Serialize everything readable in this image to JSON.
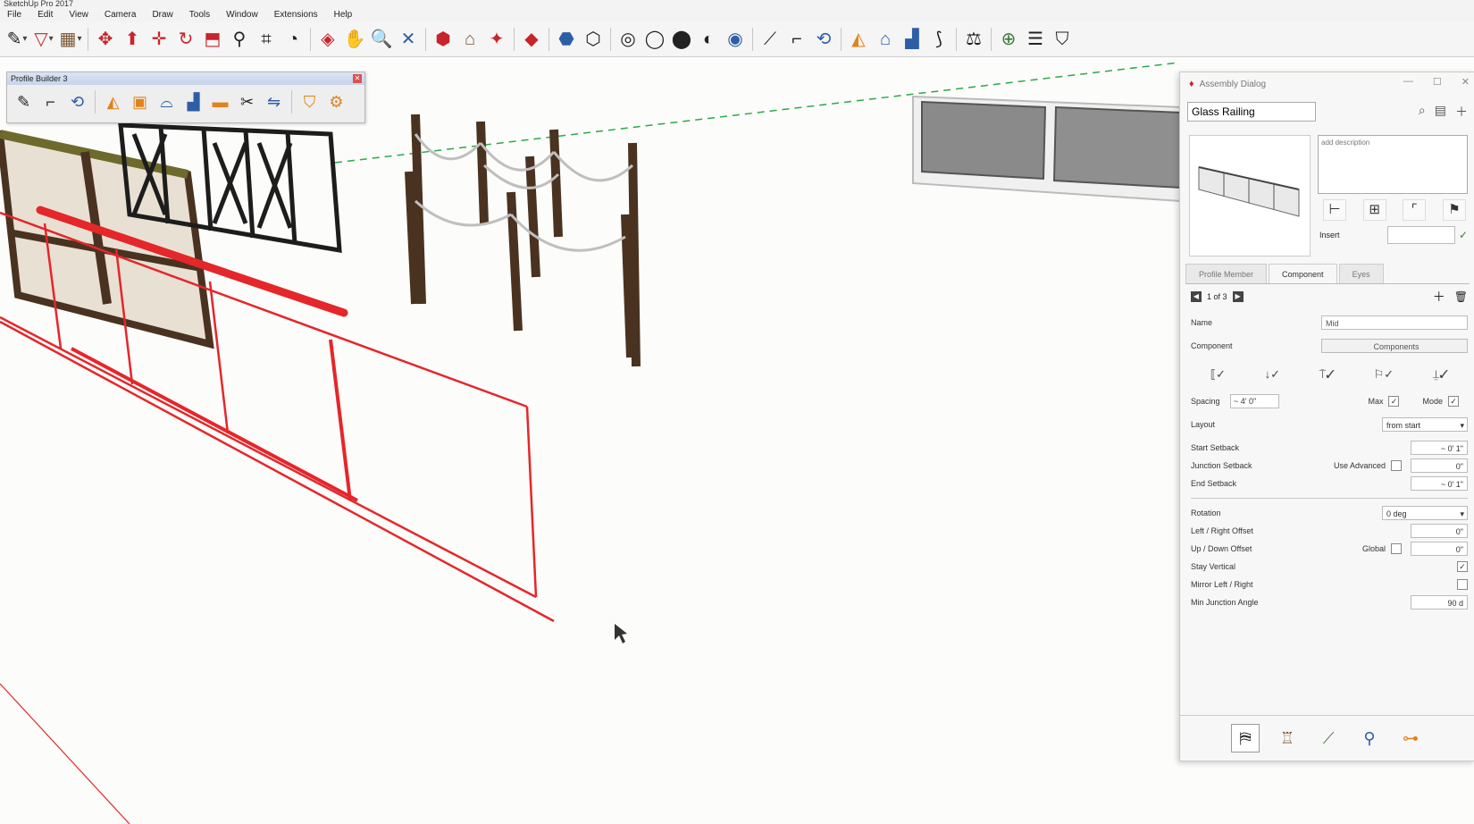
{
  "app": {
    "title": "SketchUp Pro 2017"
  },
  "menus": [
    "File",
    "Edit",
    "View",
    "Camera",
    "Draw",
    "Tools",
    "Window",
    "Extensions",
    "Help"
  ],
  "main_toolbar": {
    "tools": [
      {
        "name": "pencil-icon",
        "glyph": "✎",
        "cls": "c-dark drop"
      },
      {
        "name": "shape-icon",
        "glyph": "▽",
        "cls": "c-red drop"
      },
      {
        "name": "paint-icon",
        "glyph": "▦",
        "cls": "c-brown drop"
      },
      {
        "name": "sep"
      },
      {
        "name": "move-icon",
        "glyph": "✥",
        "cls": "c-red"
      },
      {
        "name": "push-pull-icon",
        "glyph": "⬆",
        "cls": "c-red"
      },
      {
        "name": "move-arrows-icon",
        "glyph": "✛",
        "cls": "c-red"
      },
      {
        "name": "rotate-icon",
        "glyph": "↻",
        "cls": "c-red"
      },
      {
        "name": "scale-icon",
        "glyph": "⬒",
        "cls": "c-red"
      },
      {
        "name": "tape-measure-icon",
        "glyph": "⚲",
        "cls": "c-dark"
      },
      {
        "name": "dimension-icon",
        "glyph": "⌗",
        "cls": "c-dark"
      },
      {
        "name": "protractor-icon",
        "glyph": "◔",
        "cls": "c-dark"
      },
      {
        "name": "sep"
      },
      {
        "name": "orbit-icon",
        "glyph": "◈",
        "cls": "c-red"
      },
      {
        "name": "pan-icon",
        "glyph": "✋",
        "cls": "c-orange"
      },
      {
        "name": "zoom-icon",
        "glyph": "🔍",
        "cls": "c-dark"
      },
      {
        "name": "zoom-extents-icon",
        "glyph": "✕",
        "cls": "c-blue"
      },
      {
        "name": "sep"
      },
      {
        "name": "component-icon",
        "glyph": "⬢",
        "cls": "c-red"
      },
      {
        "name": "warehouse-icon",
        "glyph": "⌂",
        "cls": "c-brown"
      },
      {
        "name": "extension-icon",
        "glyph": "✦",
        "cls": "c-red"
      },
      {
        "name": "sep"
      },
      {
        "name": "section-icon",
        "glyph": "◆",
        "cls": "c-red"
      },
      {
        "name": "sep"
      },
      {
        "name": "solid-icon",
        "glyph": "⬣",
        "cls": "c-blue"
      },
      {
        "name": "hidden-line-icon",
        "glyph": "⬡",
        "cls": "c-dark"
      },
      {
        "name": "sep"
      },
      {
        "name": "xray-icon",
        "glyph": "◎",
        "cls": "c-dark"
      },
      {
        "name": "back-edges-icon",
        "glyph": "◯",
        "cls": "c-dark"
      },
      {
        "name": "shaded-icon",
        "glyph": "⬤",
        "cls": "c-dark"
      },
      {
        "name": "shaded-texture-icon",
        "glyph": "◐",
        "cls": "c-dark"
      },
      {
        "name": "monochrome-icon",
        "glyph": "◉",
        "cls": "c-blue"
      },
      {
        "name": "sep"
      },
      {
        "name": "line-tool-icon",
        "glyph": "⟋",
        "cls": "c-dark"
      },
      {
        "name": "path-icon",
        "glyph": "⌐",
        "cls": "c-dark"
      },
      {
        "name": "follow-me-icon",
        "glyph": "⟲",
        "cls": "c-blue"
      },
      {
        "name": "sep"
      },
      {
        "name": "builder-icon",
        "glyph": "◭",
        "cls": "c-orange"
      },
      {
        "name": "house-icon",
        "glyph": "⌂",
        "cls": "c-blue"
      },
      {
        "name": "stair-icon",
        "glyph": "▟",
        "cls": "c-blue"
      },
      {
        "name": "trim-icon",
        "glyph": "⟆",
        "cls": "c-dark"
      },
      {
        "name": "sep"
      },
      {
        "name": "scale-tool-icon",
        "glyph": "⚖",
        "cls": "c-dark"
      },
      {
        "name": "sep"
      },
      {
        "name": "location-icon",
        "glyph": "⊕",
        "cls": "c-green"
      },
      {
        "name": "report-icon",
        "glyph": "☰",
        "cls": "c-dark"
      },
      {
        "name": "tag-icon",
        "glyph": "⛉",
        "cls": "c-dark"
      }
    ]
  },
  "profile_toolbar": {
    "title": "Profile Builder 3",
    "tools": [
      {
        "name": "pb-pencil-icon",
        "glyph": "✎",
        "cls": "c-dark"
      },
      {
        "name": "pb-path-icon",
        "glyph": "⌐",
        "cls": "c-dark"
      },
      {
        "name": "pb-follow-icon",
        "glyph": "⟲",
        "cls": "c-blue"
      },
      {
        "name": "sep"
      },
      {
        "name": "pb-builder-icon",
        "glyph": "◭",
        "cls": "c-orange"
      },
      {
        "name": "pb-box-icon",
        "glyph": "▣",
        "cls": "c-orange"
      },
      {
        "name": "pb-dome-icon",
        "glyph": "⌓",
        "cls": "c-blue"
      },
      {
        "name": "pb-stair-icon",
        "glyph": "▟",
        "cls": "c-blue"
      },
      {
        "name": "pb-ruler-icon",
        "glyph": "▬",
        "cls": "c-orange"
      },
      {
        "name": "pb-cut-icon",
        "glyph": "✂",
        "cls": "c-dark"
      },
      {
        "name": "pb-swap-icon",
        "glyph": "⇋",
        "cls": "c-blue"
      },
      {
        "name": "sep"
      },
      {
        "name": "pb-tag-icon",
        "glyph": "⛉",
        "cls": "c-orange"
      },
      {
        "name": "pb-settings-icon",
        "glyph": "⚙",
        "cls": "c-orange"
      }
    ]
  },
  "dialog": {
    "title": "Assembly Dialog",
    "name_value": "Glass Railing",
    "description": "add description",
    "insert_label": "Insert",
    "tabs": [
      "Profile Member",
      "Component",
      "Eyes"
    ],
    "stepper": "1 of 3",
    "name_label": "Name",
    "name_field": "Mid",
    "component_label": "Component",
    "component_button": "Components",
    "spacing": {
      "label": "Spacing",
      "value": "~ 4' 0\"",
      "max_label": "Max",
      "mode_label": "Mode"
    },
    "layout": {
      "label": "Layout",
      "value": "from start"
    },
    "start_setback": {
      "label": "Start Setback",
      "value": "~ 0' 1\""
    },
    "junction_setback": {
      "label": "Junction Setback",
      "use_label": "Use Advanced",
      "value": "0\""
    },
    "end_setback": {
      "label": "End Setback",
      "value": "~ 0' 1\""
    },
    "rotation": {
      "label": "Rotation",
      "value": "0 deg"
    },
    "left_right_offset": {
      "label": "Left / Right Offset",
      "value": "0\""
    },
    "up_down_offset": {
      "label": "Up / Down Offset",
      "global_label": "Global",
      "value": "0\""
    },
    "stay_vertical": {
      "label": "Stay Vertical"
    },
    "mirror_left_right": {
      "label": "Mirror Left / Right"
    },
    "min_junction_angle": {
      "label": "Min Junction Angle",
      "value": "90 d"
    },
    "footer_icons": [
      "profile-member-icon",
      "component-icon",
      "path-icon",
      "eyedropper-icon",
      "junction-icon"
    ]
  },
  "colors": {
    "red_guide": "#e5262a",
    "green_axis": "#2ea84a",
    "wood": "#5a3d22",
    "dialog_bg": "#f7f7f7"
  }
}
